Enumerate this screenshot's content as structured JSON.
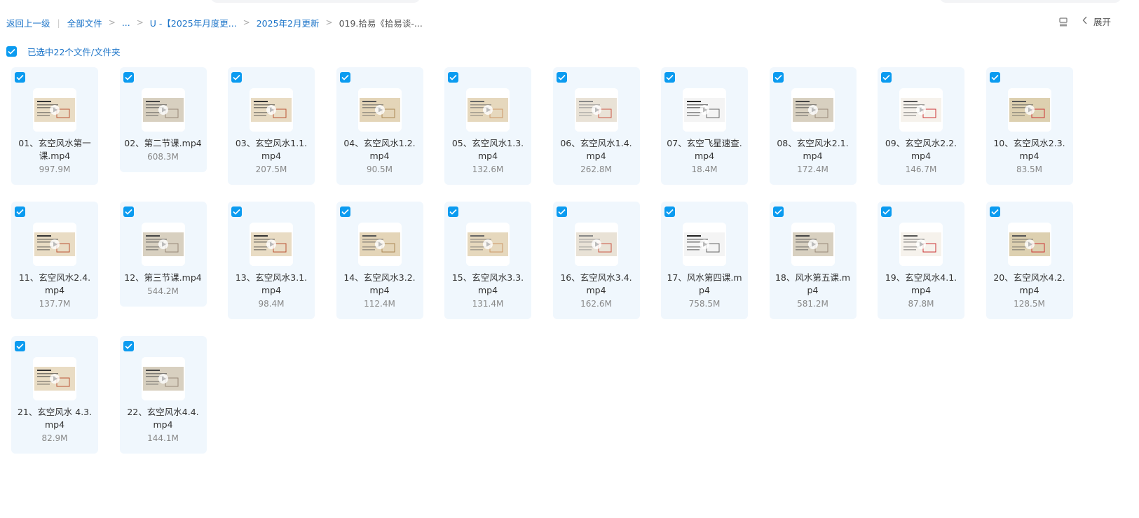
{
  "breadcrumb": {
    "back": "返回上一级",
    "items": [
      "全部文件",
      "...",
      "U -【2025年月度更...",
      "2025年2月更新"
    ],
    "current": "019.拾易《拾易谈-..."
  },
  "toolbar": {
    "expand_label": "展开",
    "view_icon": "list-view-icon",
    "collapse_icon": "chevron-left-icon"
  },
  "selection": {
    "label": "已选中22个文件/文件夹",
    "checked": true
  },
  "colors": {
    "accent": "#0b9bf0",
    "link": "#1a73c8",
    "card_bg": "#f0f7fd"
  },
  "files": [
    {
      "name": "01、玄空风水第一课.mp4",
      "size": "997.9M"
    },
    {
      "name": "02、第二节课.mp4",
      "size": "608.3M"
    },
    {
      "name": "03、玄空风水1.1.mp4",
      "size": "207.5M"
    },
    {
      "name": "04、玄空风水1.2.mp4",
      "size": "90.5M"
    },
    {
      "name": "05、玄空风水1.3.mp4",
      "size": "132.6M"
    },
    {
      "name": "06、玄空风水1.4.mp4",
      "size": "262.8M"
    },
    {
      "name": "07、玄空飞星速查.mp4",
      "size": "18.4M"
    },
    {
      "name": "08、玄空风水2.1.mp4",
      "size": "172.4M"
    },
    {
      "name": "09、玄空风水2.2.mp4",
      "size": "146.7M"
    },
    {
      "name": "10、玄空风水2.3.mp4",
      "size": "83.5M"
    },
    {
      "name": "11、玄空风水2.4.mp4",
      "size": "137.7M"
    },
    {
      "name": "12、第三节课.mp4",
      "size": "544.2M"
    },
    {
      "name": "13、玄空风水3.1.mp4",
      "size": "98.4M"
    },
    {
      "name": "14、玄空风水3.2.mp4",
      "size": "112.4M"
    },
    {
      "name": "15、玄空风水3.3.mp4",
      "size": "131.4M"
    },
    {
      "name": "16、玄空风水3.4.mp4",
      "size": "162.6M"
    },
    {
      "name": "17、风水第四课.mp4",
      "size": "758.5M"
    },
    {
      "name": "18、风水第五课.mp4",
      "size": "581.2M"
    },
    {
      "name": "19、玄空风水4.1.mp4",
      "size": "87.8M"
    },
    {
      "name": "20、玄空风水4.2.mp4",
      "size": "128.5M"
    },
    {
      "name": "21、玄空风水 4.3.mp4",
      "size": "82.9M"
    },
    {
      "name": "22、玄空风水4.4.mp4",
      "size": "144.1M"
    }
  ]
}
